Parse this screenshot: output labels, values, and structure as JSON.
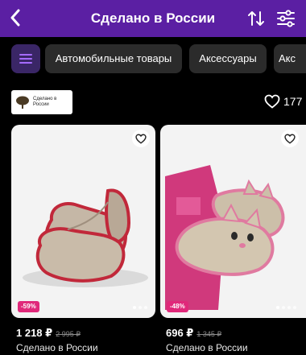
{
  "header": {
    "title": "Сделано в России",
    "back_icon": "chevron-left-icon",
    "sort_icon": "sort-arrows-icon",
    "filter_icon": "filter-sliders-icon"
  },
  "chips": {
    "menu_icon": "menu-icon",
    "items": [
      "Автомобильные товары",
      "Аксессуары",
      "Акс"
    ]
  },
  "brand": {
    "logo_text": "Сделано в России",
    "favorites_count": "177"
  },
  "products": [
    {
      "discount": "-59%",
      "price": "1 218 ₽",
      "old_price": "2 995 ₽",
      "seller": "Сделано в России"
    },
    {
      "discount": "-48%",
      "price": "696 ₽",
      "old_price": "1 345 ₽",
      "seller": "Сделано в России"
    }
  ],
  "colors": {
    "header_bg": "#5b1fa3",
    "accent": "#a56bff",
    "discount": "#e0287a",
    "background": "#000000"
  }
}
